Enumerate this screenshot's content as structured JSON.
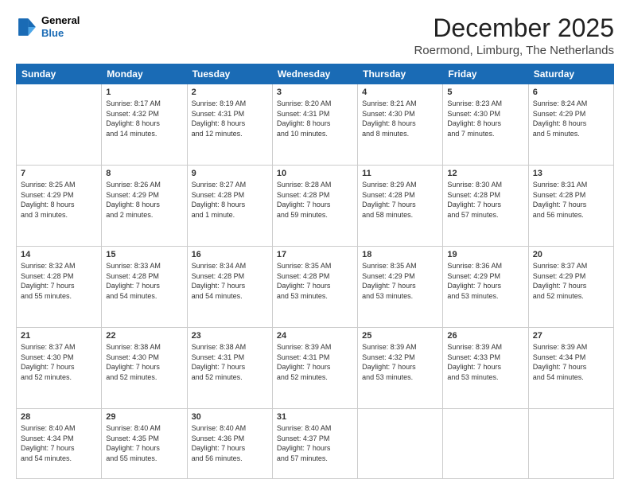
{
  "logo": {
    "line1": "General",
    "line2": "Blue"
  },
  "title": "December 2025",
  "subtitle": "Roermond, Limburg, The Netherlands",
  "days_of_week": [
    "Sunday",
    "Monday",
    "Tuesday",
    "Wednesday",
    "Thursday",
    "Friday",
    "Saturday"
  ],
  "weeks": [
    [
      {
        "day": "",
        "info": ""
      },
      {
        "day": "1",
        "info": "Sunrise: 8:17 AM\nSunset: 4:32 PM\nDaylight: 8 hours\nand 14 minutes."
      },
      {
        "day": "2",
        "info": "Sunrise: 8:19 AM\nSunset: 4:31 PM\nDaylight: 8 hours\nand 12 minutes."
      },
      {
        "day": "3",
        "info": "Sunrise: 8:20 AM\nSunset: 4:31 PM\nDaylight: 8 hours\nand 10 minutes."
      },
      {
        "day": "4",
        "info": "Sunrise: 8:21 AM\nSunset: 4:30 PM\nDaylight: 8 hours\nand 8 minutes."
      },
      {
        "day": "5",
        "info": "Sunrise: 8:23 AM\nSunset: 4:30 PM\nDaylight: 8 hours\nand 7 minutes."
      },
      {
        "day": "6",
        "info": "Sunrise: 8:24 AM\nSunset: 4:29 PM\nDaylight: 8 hours\nand 5 minutes."
      }
    ],
    [
      {
        "day": "7",
        "info": "Sunrise: 8:25 AM\nSunset: 4:29 PM\nDaylight: 8 hours\nand 3 minutes."
      },
      {
        "day": "8",
        "info": "Sunrise: 8:26 AM\nSunset: 4:29 PM\nDaylight: 8 hours\nand 2 minutes."
      },
      {
        "day": "9",
        "info": "Sunrise: 8:27 AM\nSunset: 4:28 PM\nDaylight: 8 hours\nand 1 minute."
      },
      {
        "day": "10",
        "info": "Sunrise: 8:28 AM\nSunset: 4:28 PM\nDaylight: 7 hours\nand 59 minutes."
      },
      {
        "day": "11",
        "info": "Sunrise: 8:29 AM\nSunset: 4:28 PM\nDaylight: 7 hours\nand 58 minutes."
      },
      {
        "day": "12",
        "info": "Sunrise: 8:30 AM\nSunset: 4:28 PM\nDaylight: 7 hours\nand 57 minutes."
      },
      {
        "day": "13",
        "info": "Sunrise: 8:31 AM\nSunset: 4:28 PM\nDaylight: 7 hours\nand 56 minutes."
      }
    ],
    [
      {
        "day": "14",
        "info": "Sunrise: 8:32 AM\nSunset: 4:28 PM\nDaylight: 7 hours\nand 55 minutes."
      },
      {
        "day": "15",
        "info": "Sunrise: 8:33 AM\nSunset: 4:28 PM\nDaylight: 7 hours\nand 54 minutes."
      },
      {
        "day": "16",
        "info": "Sunrise: 8:34 AM\nSunset: 4:28 PM\nDaylight: 7 hours\nand 54 minutes."
      },
      {
        "day": "17",
        "info": "Sunrise: 8:35 AM\nSunset: 4:28 PM\nDaylight: 7 hours\nand 53 minutes."
      },
      {
        "day": "18",
        "info": "Sunrise: 8:35 AM\nSunset: 4:29 PM\nDaylight: 7 hours\nand 53 minutes."
      },
      {
        "day": "19",
        "info": "Sunrise: 8:36 AM\nSunset: 4:29 PM\nDaylight: 7 hours\nand 53 minutes."
      },
      {
        "day": "20",
        "info": "Sunrise: 8:37 AM\nSunset: 4:29 PM\nDaylight: 7 hours\nand 52 minutes."
      }
    ],
    [
      {
        "day": "21",
        "info": "Sunrise: 8:37 AM\nSunset: 4:30 PM\nDaylight: 7 hours\nand 52 minutes."
      },
      {
        "day": "22",
        "info": "Sunrise: 8:38 AM\nSunset: 4:30 PM\nDaylight: 7 hours\nand 52 minutes."
      },
      {
        "day": "23",
        "info": "Sunrise: 8:38 AM\nSunset: 4:31 PM\nDaylight: 7 hours\nand 52 minutes."
      },
      {
        "day": "24",
        "info": "Sunrise: 8:39 AM\nSunset: 4:31 PM\nDaylight: 7 hours\nand 52 minutes."
      },
      {
        "day": "25",
        "info": "Sunrise: 8:39 AM\nSunset: 4:32 PM\nDaylight: 7 hours\nand 53 minutes."
      },
      {
        "day": "26",
        "info": "Sunrise: 8:39 AM\nSunset: 4:33 PM\nDaylight: 7 hours\nand 53 minutes."
      },
      {
        "day": "27",
        "info": "Sunrise: 8:39 AM\nSunset: 4:34 PM\nDaylight: 7 hours\nand 54 minutes."
      }
    ],
    [
      {
        "day": "28",
        "info": "Sunrise: 8:40 AM\nSunset: 4:34 PM\nDaylight: 7 hours\nand 54 minutes."
      },
      {
        "day": "29",
        "info": "Sunrise: 8:40 AM\nSunset: 4:35 PM\nDaylight: 7 hours\nand 55 minutes."
      },
      {
        "day": "30",
        "info": "Sunrise: 8:40 AM\nSunset: 4:36 PM\nDaylight: 7 hours\nand 56 minutes."
      },
      {
        "day": "31",
        "info": "Sunrise: 8:40 AM\nSunset: 4:37 PM\nDaylight: 7 hours\nand 57 minutes."
      },
      {
        "day": "",
        "info": ""
      },
      {
        "day": "",
        "info": ""
      },
      {
        "day": "",
        "info": ""
      }
    ]
  ]
}
